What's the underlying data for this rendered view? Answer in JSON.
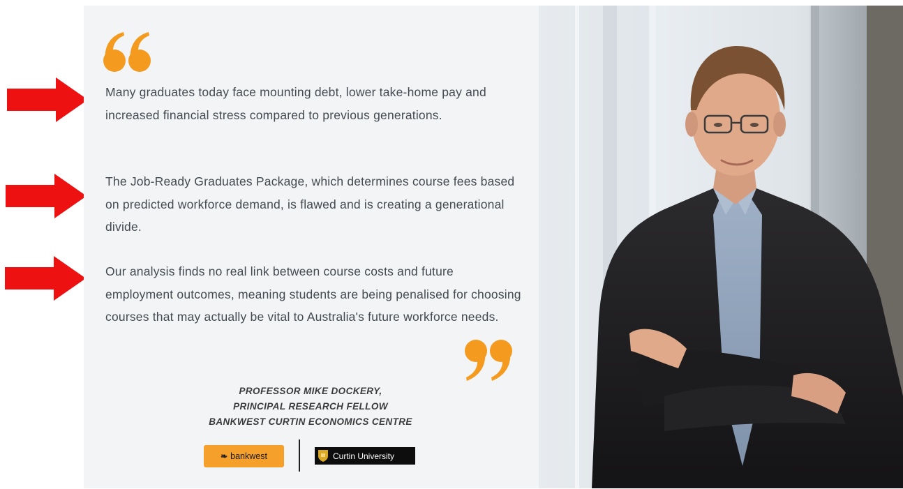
{
  "quote": {
    "paragraphs": [
      "Many graduates today face mounting debt, lower take-home pay and increased financial stress compared to previous generations.",
      "The Job-Ready Graduates Package, which determines course fees based on predicted workforce demand, is flawed and is creating a generational divide.",
      "Our analysis finds no real link between course costs and future employment outcomes, meaning students are being penalised for choosing courses that may actually be vital to Australia's future workforce needs."
    ],
    "accent_color": "#f39a1f"
  },
  "attribution": {
    "name": "PROFESSOR MIKE DOCKERY,",
    "role": "PRINCIPAL RESEARCH FELLOW",
    "organisation": "BANKWEST CURTIN ECONOMICS CENTRE"
  },
  "logos": {
    "bankwest": "bankwest",
    "curtin": "Curtin University"
  },
  "arrow_color": "#ee1111",
  "photo": {
    "subject": "portrait-icon"
  }
}
